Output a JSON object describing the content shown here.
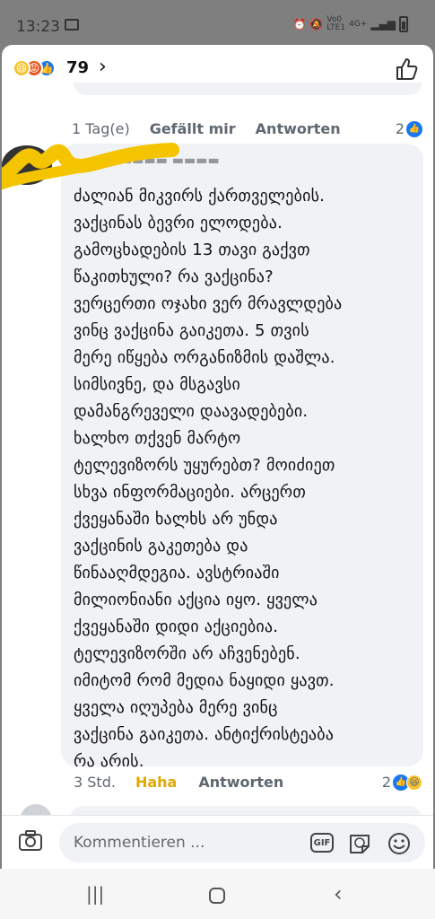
{
  "statusbar": {
    "time": "13:23",
    "network_top": "Vo0",
    "network_bottom": "LTE1",
    "signal": "4G+"
  },
  "header": {
    "reaction_count": "79",
    "chevron": "›",
    "reactions": [
      "haha",
      "angry",
      "like"
    ]
  },
  "previous_reply": {
    "time": "1 Tag(e)",
    "like_label": "Gefällt mir",
    "reply_label": "Antworten",
    "count": "2"
  },
  "comment": {
    "text": "ძალიან მიკვირს ქართველების.\nვაქცინას ბევრი ელოდება.\nგამოცხადების 13 თავი გაქვთ\nწაკითხული? რა ვაქცინა?\nვერცერთი ოჯახი ვერ მრავლდება\nვინც ვაქცინა გაიკეთა. 5 თვის\nმერე იწყება ორგანიზმის დაშლა.\nსიმსივნე, და მსგავსი\nდამანგრეველი დაავადებები.\nხალხო თქვენ მარტო\nტელევიზორს უყურებთ? მოიძიეთ\nსხვა ინფორმაციები. არცერთ\nქვეყანაში ხალხს არ უნდა\nვაქცინის გაკეთება და\nწინააღმდეგია. ავსტრიაში\nმილიონიანი აქცია იყო. ყველა\nქვეყანაში დიდი აქციებია.\nტელევიზორში არ აჩვენებენ.\nიმიტომ რომ მედია ნაყიდი ყავთ.\nყველა იღუპება მერე ვინც\nვაქცინა გაიკეთა. ანტიქრისტეაბა\nრა არის.",
    "time": "3 Std.",
    "reaction_label": "Haha",
    "reply_label": "Antworten",
    "count": "2"
  },
  "composer": {
    "placeholder": "Kommentieren ...",
    "gif_label": "GIF"
  },
  "colors": {
    "accent": "#1877f2",
    "haha": "#f7c32e",
    "angry": "#e9571d",
    "scribble": "#f5c400"
  }
}
